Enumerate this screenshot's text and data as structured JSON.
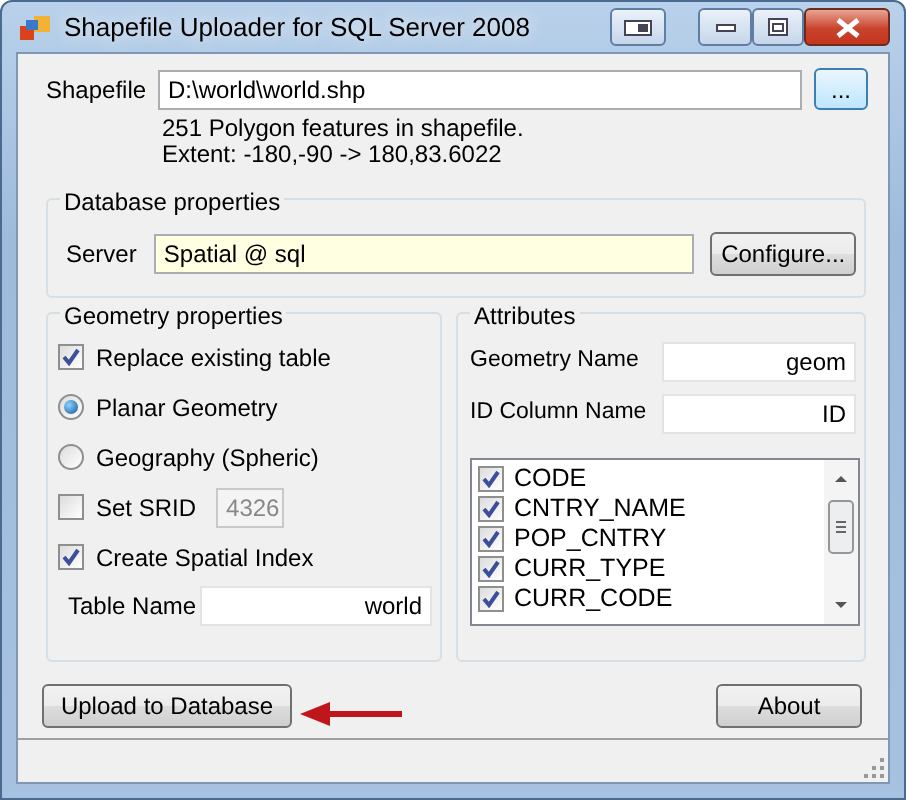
{
  "window": {
    "title": "Shapefile Uploader for SQL Server 2008"
  },
  "shapefile": {
    "label": "Shapefile",
    "value": "D:\\world\\world.shp",
    "browse": "..."
  },
  "info": [
    "251 Polygon features in shapefile.",
    "Extent: -180,-90 -> 180,83.6022"
  ],
  "database": {
    "title": "Database properties",
    "server_label": "Server",
    "server": "Spatial @ sql",
    "configure": "Configure..."
  },
  "geometry": {
    "title": "Geometry properties",
    "options": [
      {
        "kind": "checkbox",
        "label": "Replace existing table",
        "checked": true
      },
      {
        "kind": "radio",
        "label": "Planar Geometry",
        "selected": true
      },
      {
        "kind": "radio",
        "label": "Geography (Spheric)",
        "selected": false
      },
      {
        "kind": "checkbox",
        "label": "Set SRID",
        "checked": false,
        "field": {
          "value": "4326",
          "disabled": true
        }
      },
      {
        "kind": "checkbox",
        "label": "Create Spatial Index",
        "checked": true
      }
    ],
    "table_name_label": "Table Name",
    "table_name": "world"
  },
  "attributes": {
    "title": "Attributes",
    "geometry_name_label": "Geometry Name",
    "geometry_name": "geom",
    "id_label": "ID Column Name",
    "id_value": "ID",
    "columns": [
      {
        "label": "CODE",
        "checked": true
      },
      {
        "label": "CNTRY_NAME",
        "checked": true
      },
      {
        "label": "POP_CNTRY",
        "checked": true
      },
      {
        "label": "CURR_TYPE",
        "checked": true
      },
      {
        "label": "CURR_CODE",
        "checked": true
      }
    ]
  },
  "buttons": {
    "upload": "Upload to Database",
    "about": "About"
  }
}
